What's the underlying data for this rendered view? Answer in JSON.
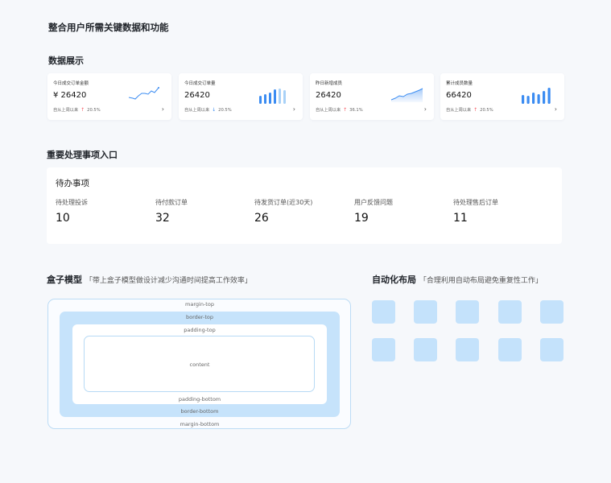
{
  "page_title": "整合用户所需关键数据和功能",
  "section_data": "数据展示",
  "stat_cards": [
    {
      "label": "今日成交订单金额",
      "value": "¥ 26420",
      "trend_text": "自从上周以来",
      "direction": "up",
      "percent": "20.5%",
      "chart": "line"
    },
    {
      "label": "今日成交订单量",
      "value": "26420",
      "trend_text": "自从上周以来",
      "direction": "down",
      "percent": "20.5%",
      "chart": "bar"
    },
    {
      "label": "昨日新增成员",
      "value": "26420",
      "trend_text": "自从上周以来",
      "direction": "up",
      "percent": "36.1%",
      "chart": "area"
    },
    {
      "label": "累计成员数量",
      "value": "66420",
      "trend_text": "自从上周以来",
      "direction": "up",
      "percent": "20.5%",
      "chart": "bar"
    }
  ],
  "arrows": {
    "up": "↑",
    "down": "↓"
  },
  "colors": {
    "accent": "#3b8cf2",
    "accent_light": "#a9d1f7",
    "up": "#f5555e",
    "tile": "#c4e2fb"
  },
  "section_entry": "重要处理事项入口",
  "todo": {
    "title": "待办事项",
    "items": [
      {
        "label": "待处理投诉",
        "value": "10"
      },
      {
        "label": "待付款订单",
        "value": "32"
      },
      {
        "label": "待发货订单(近30天)",
        "value": "26"
      },
      {
        "label": "用户反馈问题",
        "value": "19"
      },
      {
        "label": "待处理售后订单",
        "value": "11"
      }
    ]
  },
  "box_model": {
    "title": "盒子模型",
    "subtitle": "「带上盒子模型做设计减少沟通时间提高工作效率」",
    "margin_top": "margin-top",
    "border_top": "border-top",
    "padding_top": "padding-top",
    "content": "content",
    "padding_bottom": "padding-bottom",
    "border_bottom": "border-bottom",
    "margin_bottom": "margin-bottom"
  },
  "auto_layout": {
    "title": "自动化布局",
    "subtitle": "「合理利用自动布局避免重复性工作」",
    "tile_count": 10
  }
}
